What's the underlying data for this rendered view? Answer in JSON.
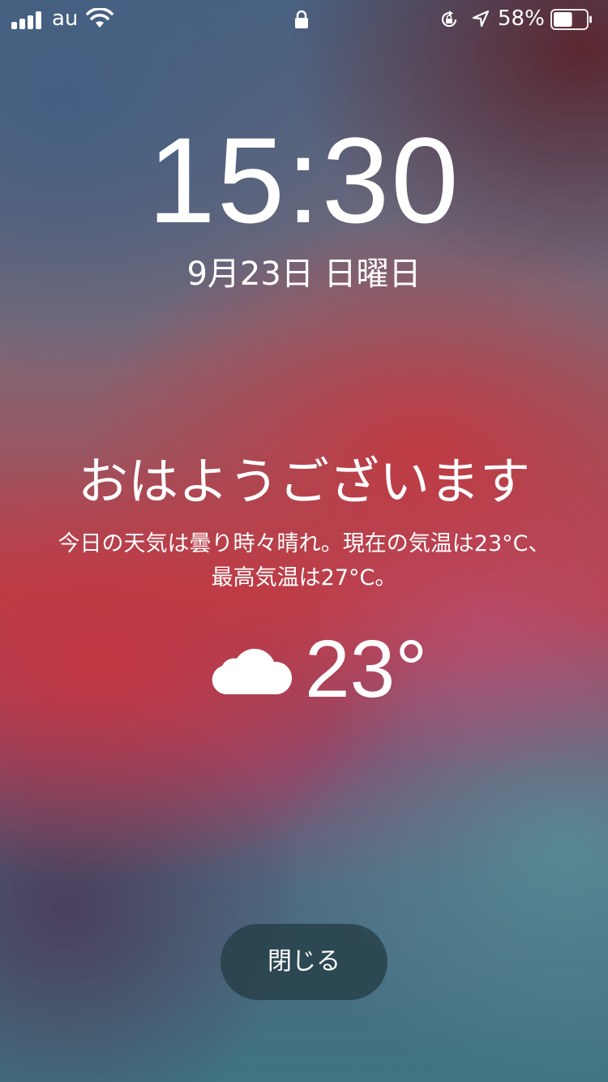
{
  "status_bar": {
    "carrier": "au",
    "battery_percent": "58%",
    "battery_level": 0.58,
    "icons": [
      "signal-icon",
      "wifi-icon",
      "lock-icon",
      "rotation-lock-icon",
      "location-icon",
      "battery-icon"
    ]
  },
  "lock_screen": {
    "time": "15:30",
    "date": "9月23日 日曜日"
  },
  "bedtime_greeting": {
    "greeting": "おはようございます",
    "forecast_line1": "今日の天気は曇り時々晴れ。現在の気温は23°C、",
    "forecast_line2": "最高気温は27°C。",
    "weather_icon": "cloud-icon",
    "temperature": "23°"
  },
  "actions": {
    "close_label": "閉じる"
  },
  "colors": {
    "text": "#ffffff",
    "button_bg": "#264048"
  }
}
